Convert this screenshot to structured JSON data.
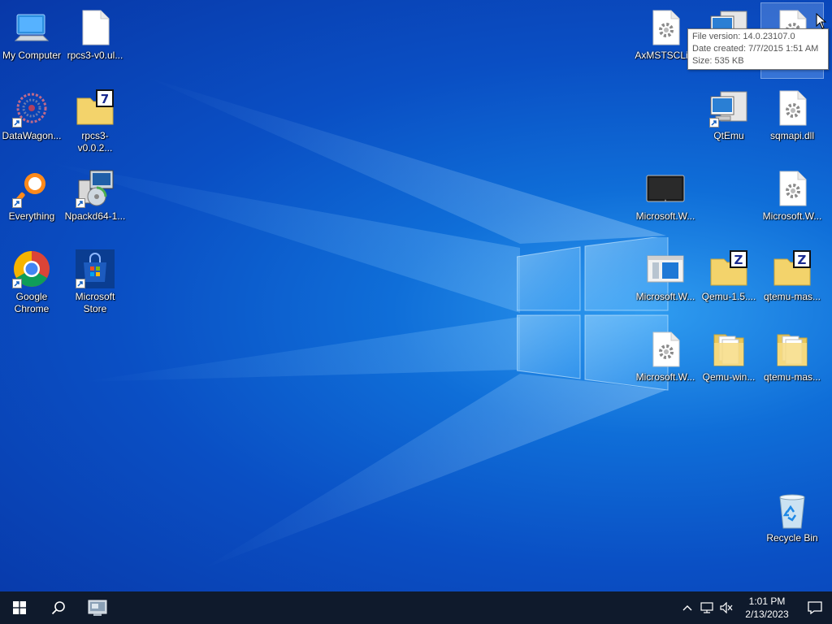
{
  "desktop": {
    "icons": [
      {
        "label": "My Computer",
        "icon": "computer-icon"
      },
      {
        "label": "rpcs3-v0.ul...",
        "icon": "blank-file-icon"
      },
      {
        "label": "DataWagon...",
        "icon": "datawagon-icon"
      },
      {
        "label": "rpcs3-v0.0.2...",
        "icon": "7zip-archive-icon"
      },
      {
        "label": "Everything",
        "icon": "everything-search-icon"
      },
      {
        "label": "Npackd64-1...",
        "icon": "installer-icon"
      },
      {
        "label": "Google Chrome",
        "icon": "chrome-icon"
      },
      {
        "label": "Microsoft Store",
        "icon": "store-icon"
      },
      {
        "label": "AxMSTSCLi...",
        "icon": "dll-gear-file-icon"
      },
      {
        "label": "",
        "icon": "qtemu-computer-icon"
      },
      {
        "label": "",
        "icon": "dll-gear-file-icon"
      },
      {
        "label": "QtEmu",
        "icon": "qtemu-computer-icon"
      },
      {
        "label": "sqmapi.dll",
        "icon": "dll-gear-file-icon"
      },
      {
        "label": "Microsoft.W...",
        "icon": "tablet-app-icon"
      },
      {
        "label": "Microsoft.W...",
        "icon": "dll-gear-file-icon"
      },
      {
        "label": "Microsoft.W...",
        "icon": "window-app-icon"
      },
      {
        "label": "Qemu-1.5....",
        "icon": "zip-folder-icon"
      },
      {
        "label": "qtemu-mas...",
        "icon": "zip-folder-icon"
      },
      {
        "label": "Microsoft.W...",
        "icon": "dll-gear-file-icon"
      },
      {
        "label": "Qemu-win...",
        "icon": "folder-icon"
      },
      {
        "label": "qtemu-mas...",
        "icon": "folder-icon"
      },
      {
        "label": "Recycle Bin",
        "icon": "recycle-bin-icon"
      }
    ]
  },
  "tooltip": {
    "line1": "File version: 14.0.23107.0",
    "line2": "Date created: 7/7/2015 1:51 AM",
    "line3": "Size: 535 KB"
  },
  "taskbar": {
    "start": "windows-start-icon",
    "search": "search-icon",
    "pinned_app": "control-panel-icon",
    "tray": [
      "chevron-up-icon",
      "network-icon",
      "volume-muted-icon"
    ],
    "time": "1:01 PM",
    "date": "2/13/2023",
    "notification": "action-center-icon"
  },
  "colors": {
    "taskbar": "#0f1a2c",
    "desktop_accent": "#0a4fc4"
  }
}
